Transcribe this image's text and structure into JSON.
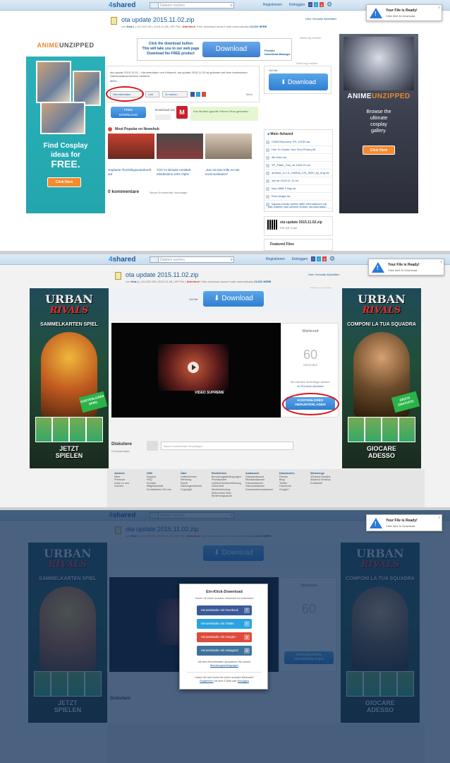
{
  "common": {
    "logo_num": "4",
    "logo_text": "shared",
    "search_placeholder": "Dateien suchen",
    "register": "Registrieren",
    "login": "Einloggen",
    "social": [
      "f",
      "t",
      "g"
    ],
    "notif_title": "Your File is Ready!",
    "notif_text": "Click here to Download.",
    "notif_close": "x",
    "view_recent": "Über Verwalte Aktivitäten",
    "file_title": "ota update 2015.11.02.zip",
    "file_meta_prefix": "von",
    "file_meta_user": "Kira L",
    "file_meta_rest": "| 411,922 KB | 2015-11-08 | ZIP File |",
    "file_warning_bold": "Attention!",
    "file_warning": "If the download doesn't start automatically",
    "file_warning_link": "CLICK HERE",
    "ad_report": "Werbung melden"
  },
  "panel1": {
    "ad_left_brand_1": "ANIME",
    "ad_left_brand_2": "UNZIPPED",
    "ad_left_line1": "Find Cosplay",
    "ad_left_line2": "ideas for",
    "ad_left_line3": "FREE.",
    "ad_left_btn": "Click Here",
    "promo_line1": "Click the download button",
    "promo_line2": "This will take you to our web page",
    "promo_line3": "Download the FREE product",
    "promo_btn": "Download",
    "promo_brand_1": "Premier",
    "promo_brand_2": "Download Manager",
    "desc": "ota update 2015.11.02 – Herunterladen von Kshared. ota update 2015.11.02 ist gehostet auf dem kostenlosen Dateiaustauschservice 4shared.",
    "more": "Mehr...",
    "share_download": "Herunterladen",
    "share_link": "Link",
    "share_zu": "Zu meine...",
    "share_more": "Mehr",
    "free_btn_1": "FREE",
    "free_btn_2": "DOWNLOAD",
    "download_via": "Download via:",
    "mcafee_text": "Von McAfee geprüft: Keinen Virus gefunden.",
    "getfile_label": "Get file",
    "side_download": "Download",
    "popular_title": "Most Popular on Newshub",
    "popular": [
      {
        "caption": "Geplante Flüchtlingsunterkunft auf"
      },
      {
        "caption": "TÜV im Einsatz ermittelt Mindestens zehn Opfer"
      },
      {
        "caption": "„Sex ist eine tolle Art der Kommunikation“"
      }
    ],
    "comments_count": "0 kommentare",
    "comments_sort": "Neues Kommentar Vorzuleger",
    "my4shared_title": "Mein 4shared",
    "my_files": [
      "CWM Recovery TPL 10700.rar",
      "Hire To Create Your First Photo.pdf",
      "life.drive.rar",
      "SP_Flash_Tool_v5.1540.01.rar",
      "android_ui 1.5_v4000a_v75_5020_by_eng.rar",
      "ota rar 2015.11.11.rar",
      "twrp x888 2.img.rar",
      "Root-image.rar",
      "kappas-handy-hybrid-4680-infomationen.zip"
    ],
    "my_link": "Alle Dateien aus diesem Ordner herunterladen",
    "qr_title": "ota update 2015.11.02.zip",
    "qr_sub": "File QR Code",
    "featured": "Featured Files",
    "ad_right_brand_1": "ANIME",
    "ad_right_brand_2": "UNZIPPED",
    "ad_right_line1": "Browse the",
    "ad_right_line2": "ultimate",
    "ad_right_line3": "cosplay",
    "ad_right_line4": "gallery.",
    "ad_right_btn": "Click Here"
  },
  "panel2": {
    "getfile_label": "Get file",
    "download_btn": "Download",
    "urban_1": "URBAN",
    "urban_2": "RIVALS",
    "urban_left_sub": "SAMMELKARTEN SPIEL",
    "urban_left_badge": "KOSTENLOSES SPIEL",
    "urban_left_bottom_1": "JETZT",
    "urban_left_bottom_2": "SPIELEN",
    "urban_right_sub": "COMPONI LA TUA SQUADRA",
    "urban_right_badge": "GIOCO GRATUITO",
    "urban_right_bottom_1": "GIOCARE",
    "urban_right_bottom_2": "ADESSO",
    "video_label": "VIDEO SUPREME",
    "wait_label": "Wartezeit",
    "wait_number": "60",
    "wait_unit": "Sekunden",
    "faster_q": "Sie möchten nicht länger warten?",
    "faster_link": "Zu Premium wechseln",
    "free_btn_1": "KOSTENLOSES",
    "free_btn_2": "HERUNTERLADEN",
    "discuss_title": "Diskutiere",
    "discuss_count": "0 kommentare",
    "discuss_placeholder": "Neuen Kommentar Hinzufügen",
    "footer_cols": [
      {
        "head": "4shared",
        "items": [
          "Mehr",
          "Premium",
          "Links zu uns",
          "Suchen"
        ]
      },
      {
        "head": "Hilfe",
        "items": [
          "Support",
          "FAQ",
          "Kontakt",
          "Mitgliedschaft",
          "Kontaktieren Sie uns"
        ]
      },
      {
        "head": "Über",
        "items": [
          "Unternehmen",
          "Werbung",
          "Recht",
          "Zahlungsmethode",
          "Copyright"
        ]
      },
      {
        "head": "Rechtliches",
        "items": [
          "Benutzungsbedingungen",
          "Privatsphäre",
          "Urheberrechtsverletzung",
          "Sicherheit",
          "Musiksicherung",
          "Abkommen über",
          "Bedienungspunkt"
        ]
      },
      {
        "head": "Austausch",
        "items": [
          "Dateiaustausch",
          "Musikaustausch",
          "Fotoaustausch",
          "Videoaustausch",
          "Dokumentenaustausch"
        ]
      },
      {
        "head": "Dazwischen",
        "items": [
          "Presse",
          "Blog",
          "Twitter",
          "Facebook",
          "Google+"
        ]
      },
      {
        "head": "Werkzeuge",
        "items": [
          "4Shared Mobiles",
          "4shared Desktop",
          "Entwickler"
        ]
      }
    ]
  },
  "panel3": {
    "modal_title": "Ein-Klick-Download",
    "modal_sub": "Sofort mit Ihrem sozialen Netzwerk herunterladen",
    "btn_facebook": "Herunterladen mit Facebook",
    "btn_twitter": "Herunterladen mit Twitter",
    "btn_google": "Herunterladen mit Google+",
    "btn_instagram": "Herunterladen mit Instagram",
    "agree_text": "Mit dem Herunterladen akzeptieren Sie unsere",
    "agree_link": "Benutzungsbedingungen",
    "no_social": "Haben Sie kein Konto bei einem sozialen Netzwerk?",
    "register_link": "Registrieren",
    "register_mid": "mit über E-Mail oder",
    "login_link": "Einloggen",
    "colors": {
      "facebook": "#3b5998",
      "twitter": "#2aa3e0",
      "google": "#dd4b39",
      "instagram": "#3f729b"
    }
  }
}
